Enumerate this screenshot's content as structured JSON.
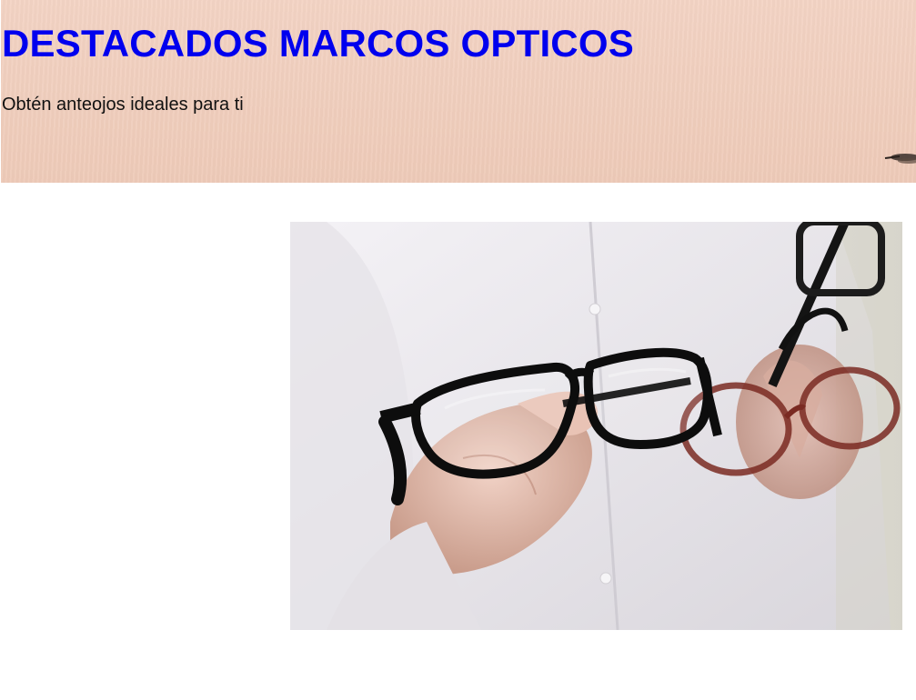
{
  "hero": {
    "title": "DESTACADOS MARCOS OPTICOS",
    "subtitle": "Obtén anteojos ideales para ti",
    "background_color": "#f1cfbf",
    "title_color": "#0000ee"
  },
  "photo": {
    "subject": "hand-holding-eyeglasses",
    "frame_colors": [
      "#111111",
      "#7a2a22"
    ]
  }
}
